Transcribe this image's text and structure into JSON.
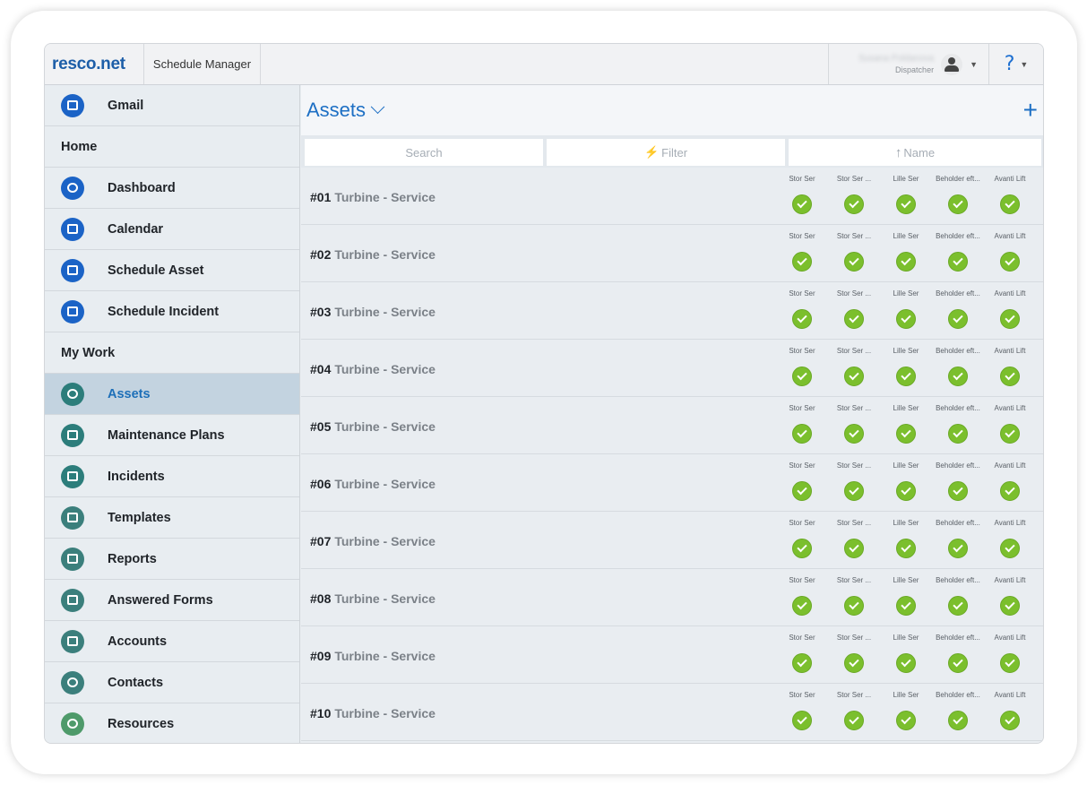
{
  "header": {
    "logo": "resco.net",
    "app_title": "Schedule Manager",
    "user_name": "Susana Poldanova",
    "user_role": "Dispatcher",
    "help_label": "?"
  },
  "sidebar": {
    "gmail": "Gmail",
    "section_home": "Home",
    "home_items": [
      "Dashboard",
      "Calendar",
      "Schedule Asset",
      "Schedule Incident"
    ],
    "section_mywork": "My Work",
    "mywork_items": [
      "Assets",
      "Maintenance Plans",
      "Incidents",
      "Templates",
      "Reports",
      "Answered Forms",
      "Accounts",
      "Contacts",
      "Resources"
    ],
    "active": "Assets"
  },
  "main": {
    "title": "Assets",
    "add_label": "+",
    "search_placeholder": "Search",
    "filter_label": "Filter",
    "sort_label": "Name",
    "status_columns": [
      "Stor Ser",
      "Stor Ser ...",
      "Lille Ser",
      "Beholder eft...",
      "Avanti Lift"
    ],
    "rows": [
      {
        "num": "#01",
        "name": "Turbine - Service"
      },
      {
        "num": "#02",
        "name": "Turbine - Service"
      },
      {
        "num": "#03",
        "name": "Turbine - Service"
      },
      {
        "num": "#04",
        "name": "Turbine - Service"
      },
      {
        "num": "#05",
        "name": "Turbine - Service"
      },
      {
        "num": "#06",
        "name": "Turbine - Service"
      },
      {
        "num": "#07",
        "name": "Turbine - Service"
      },
      {
        "num": "#08",
        "name": "Turbine - Service"
      },
      {
        "num": "#09",
        "name": "Turbine - Service"
      },
      {
        "num": "#10",
        "name": "Turbine - Service"
      }
    ]
  },
  "colors": {
    "accent": "#1d6fc4",
    "status_ok": "#7bbf2d",
    "active_bg": "#c3d3e0"
  }
}
